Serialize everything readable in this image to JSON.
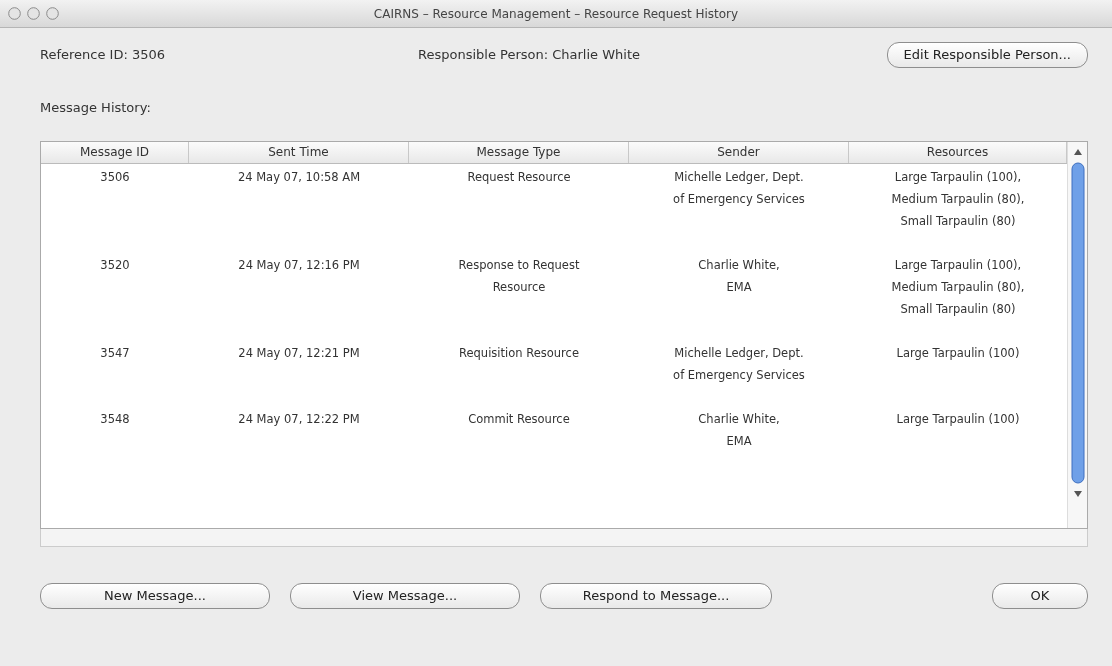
{
  "window": {
    "title": "CAIRNS – Resource Management – Resource Request History"
  },
  "reference": "Reference ID: 3506",
  "responsible": "Responsible Person: Charlie White",
  "edit_button": "Edit Responsible Person...",
  "history_label": "Message History:",
  "table": {
    "columns": [
      "Message ID",
      "Sent Time",
      "Message Type",
      "Sender",
      "Resources"
    ],
    "rows": [
      {
        "cells": [
          "3506",
          "24 May 07, 10:58 AM",
          "Request Resource",
          "Michelle Ledger, Dept.\nof Emergency Services",
          "Large Tarpaulin (100),\nMedium Tarpaulin (80),\nSmall Tarpaulin (80)"
        ]
      },
      {
        "cells": [
          "3520",
          "24 May 07, 12:16 PM",
          "Response to Request\nResource",
          "Charlie White,\nEMA",
          "Large Tarpaulin (100),\nMedium Tarpaulin (80),\nSmall Tarpaulin (80)"
        ]
      },
      {
        "cells": [
          "3547",
          "24 May 07, 12:21 PM",
          "Requisition Resource",
          "Michelle Ledger, Dept.\nof Emergency Services",
          "Large Tarpaulin (100)"
        ]
      },
      {
        "cells": [
          "3548",
          "24 May 07, 12:22 PM",
          "Commit Resource",
          "Charlie White,\nEMA",
          "Large Tarpaulin (100)"
        ]
      }
    ]
  },
  "buttons": [
    "New Message...",
    "View Message...",
    "Respond to Message..."
  ],
  "ok_button": "OK"
}
